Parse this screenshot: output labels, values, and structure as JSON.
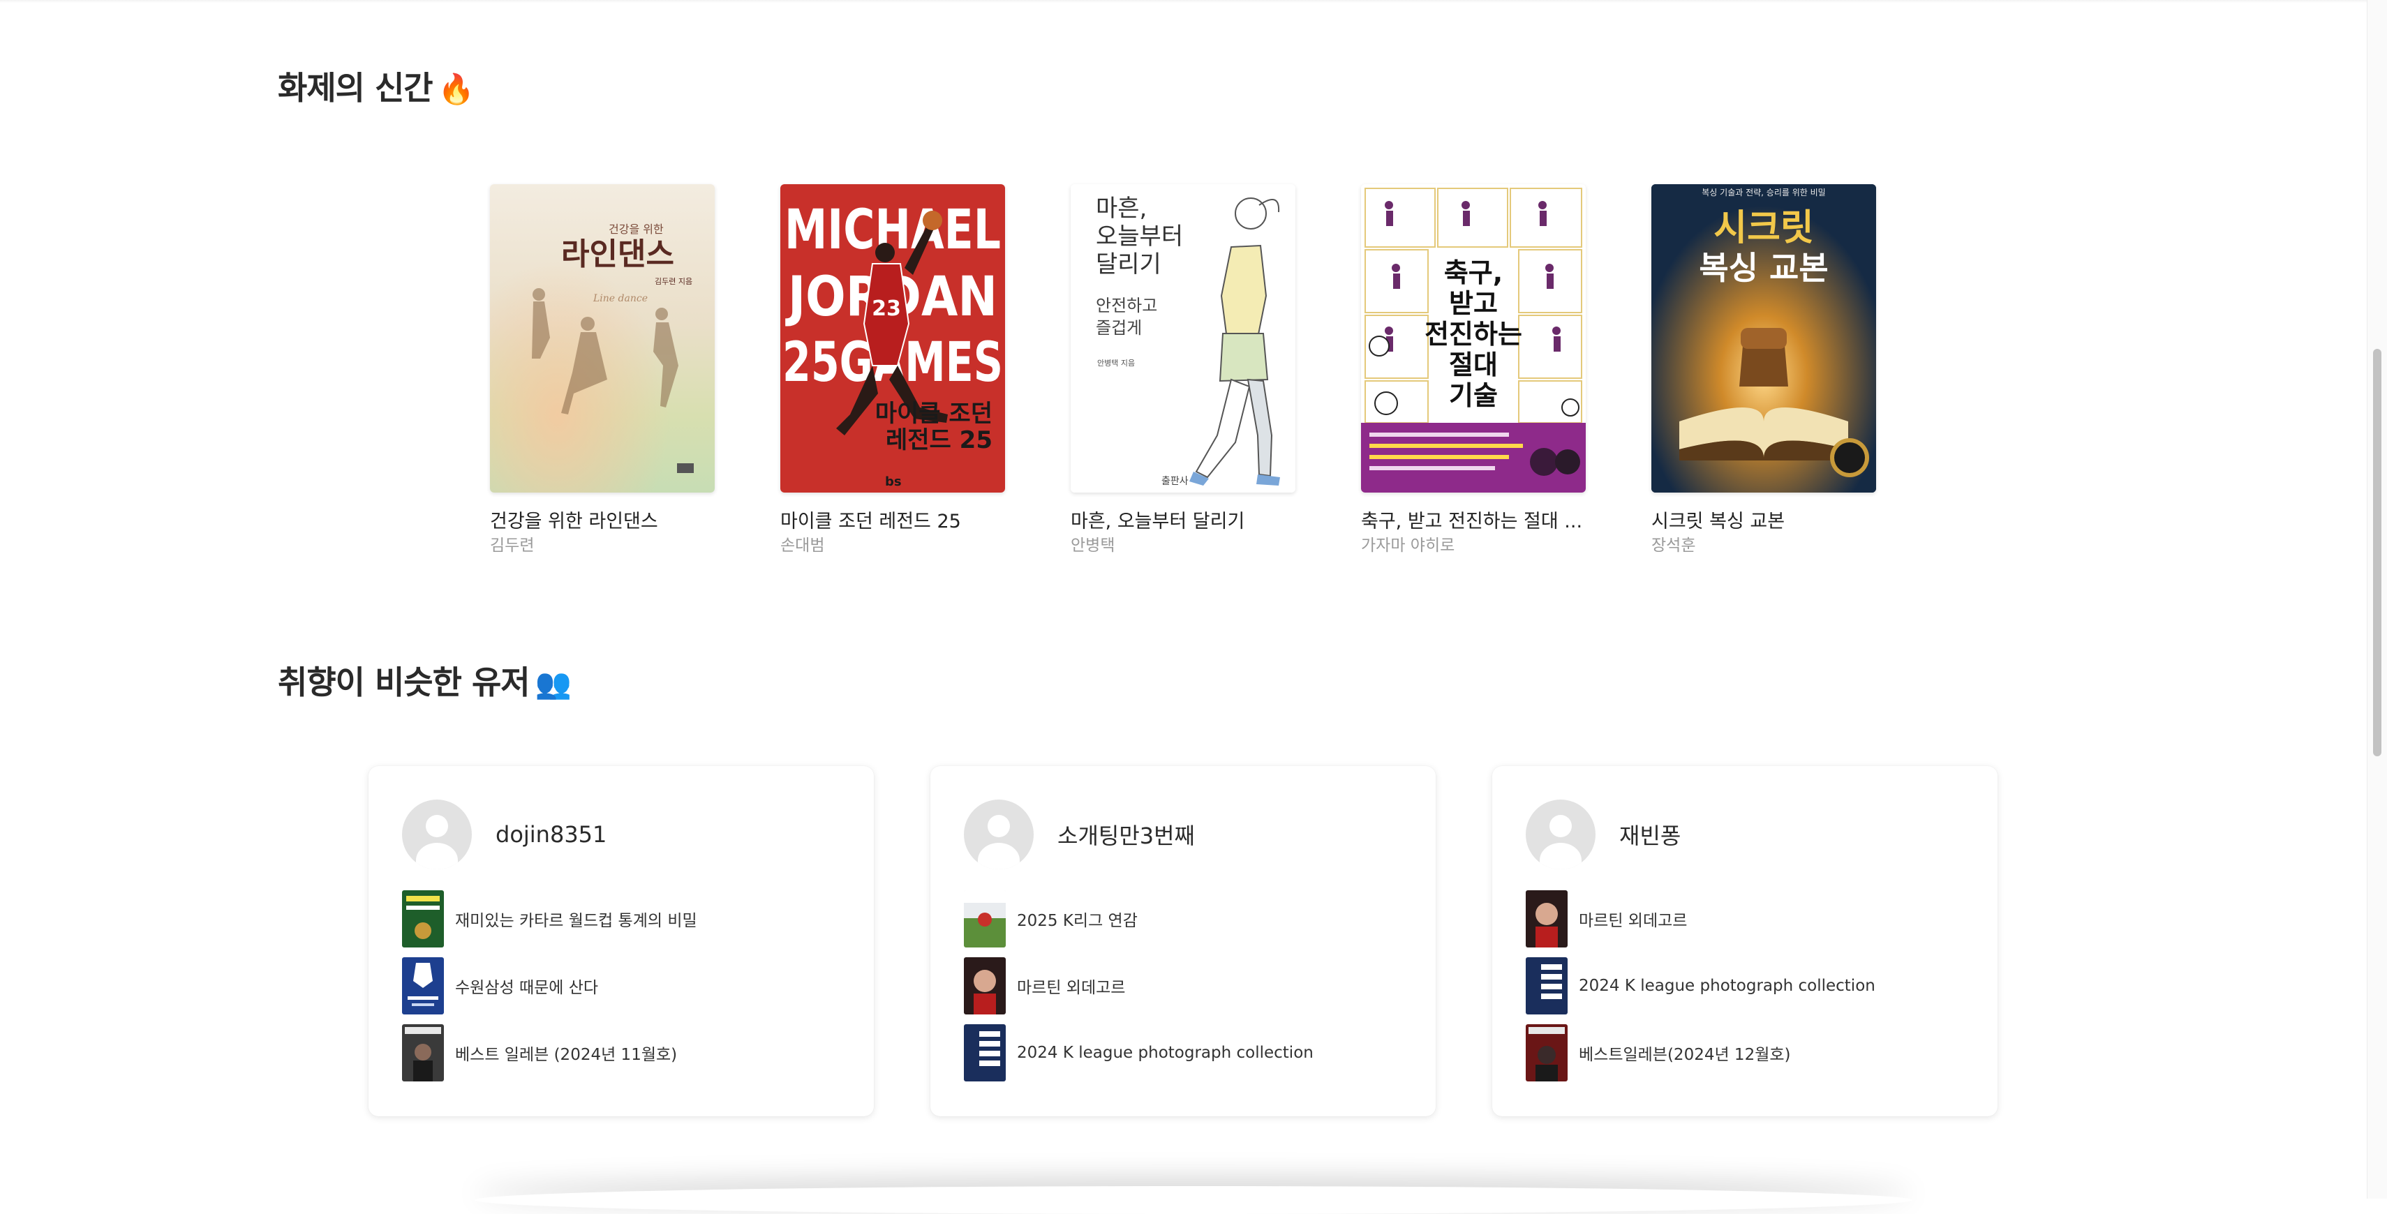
{
  "sections": {
    "new_releases": {
      "title": "화제의 신간",
      "emoji": "🔥"
    },
    "similar_users": {
      "title": "취향이 비슷한 유저",
      "emoji": "👥"
    }
  },
  "books": [
    {
      "title": "건강을 위한 라인댄스",
      "author": "김두련",
      "cover_texts": [
        "건강을 위한",
        "라인댄스",
        "김두련 지음",
        "Line dance"
      ],
      "cover_color": "#efe6d2"
    },
    {
      "title": "마이클 조던 레전드 25",
      "author": "손대범",
      "cover_texts": [
        "MICHAEL",
        "JORDAN",
        "25GAMES",
        "마이클 조던",
        "레전드 25",
        "bs"
      ],
      "cover_color": "#c8302a"
    },
    {
      "title": "마흔, 오늘부터 달리기",
      "author": "안병택",
      "cover_texts": [
        "마흔,",
        "오늘부터",
        "달리기",
        "안전하고",
        "즐겁게",
        "안병택 지음"
      ],
      "cover_color": "#ffffff"
    },
    {
      "title": "축구, 받고 전진하는 절대 ...",
      "author": "가자마 야히로",
      "cover_texts": [
        "축구,",
        "받고",
        "전진하는",
        "절대",
        "기술"
      ],
      "cover_color": "#8e2a8a"
    },
    {
      "title": "시크릿 복싱 교본",
      "author": "장석훈",
      "cover_texts": [
        "복싱 기술과 전략, 승리를 위한 비밀",
        "시크릿",
        "복싱 교본"
      ],
      "cover_color": "#152a44"
    }
  ],
  "users": [
    {
      "name": "dojin8351",
      "books": [
        {
          "title": "재미있는 카타르 월드컵 통계의 비밀",
          "color": "#1e5e2a"
        },
        {
          "title": "수원삼성 때문에 산다",
          "color": "#1d3f8f"
        },
        {
          "title": "베스트 일레븐 (2024년 11월호)",
          "color": "#3a3a3a"
        }
      ]
    },
    {
      "name": "소개팅만3번째",
      "books": [
        {
          "title": "2025 K리그 연감",
          "color": "#5c8f3a"
        },
        {
          "title": "마르틴 외데고르",
          "color": "#7a2a2a"
        },
        {
          "title": "2024 K league photograph collection",
          "color": "#1a2e5c"
        }
      ]
    },
    {
      "name": "재빈퐁",
      "books": [
        {
          "title": "마르틴 외데고르",
          "color": "#7a2a2a"
        },
        {
          "title": "2024 K league photograph collection",
          "color": "#1a2e5c"
        },
        {
          "title": "베스트일레븐(2024년 12월호)",
          "color": "#6a1616"
        }
      ]
    }
  ]
}
